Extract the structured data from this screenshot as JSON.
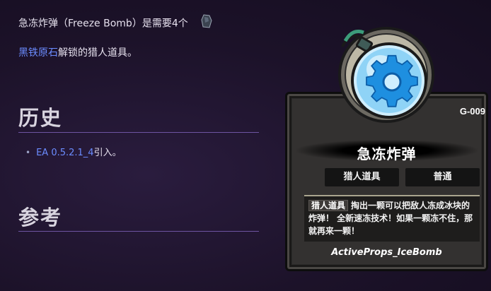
{
  "intro": {
    "line1": "急冻炸弹（Freeze Bomb）是需要4个",
    "ore_link": "黑铁原石",
    "line2_rest": "解锁的猎人道具。",
    "ore_icon": "ore-gem-icon"
  },
  "history": {
    "heading": "历史",
    "items": [
      {
        "version_link": "EA 0.5.2.1_4",
        "suffix": "引入。"
      }
    ]
  },
  "references": {
    "heading": "参考"
  },
  "card": {
    "code": "G-009",
    "name": "急冻炸弹",
    "tags": [
      "猎人道具",
      "普通"
    ],
    "desc_tag": "猎人道具",
    "description": "掏出一颗可以把敌人冻成冰块的炸弹！ 全新速冻技术！如果一颗冻不住，那就再来一颗！",
    "id": "ActiveProps_IceBomb",
    "icon": "freeze-bomb-icon",
    "colors": {
      "frame": "#2b2a2a",
      "bomb_blue": "#3aa7ea",
      "gear": "#1e8fe0"
    }
  },
  "colors": {
    "link": "#6b8cff",
    "rule": "#6e54a2",
    "background": "#1c1229"
  }
}
